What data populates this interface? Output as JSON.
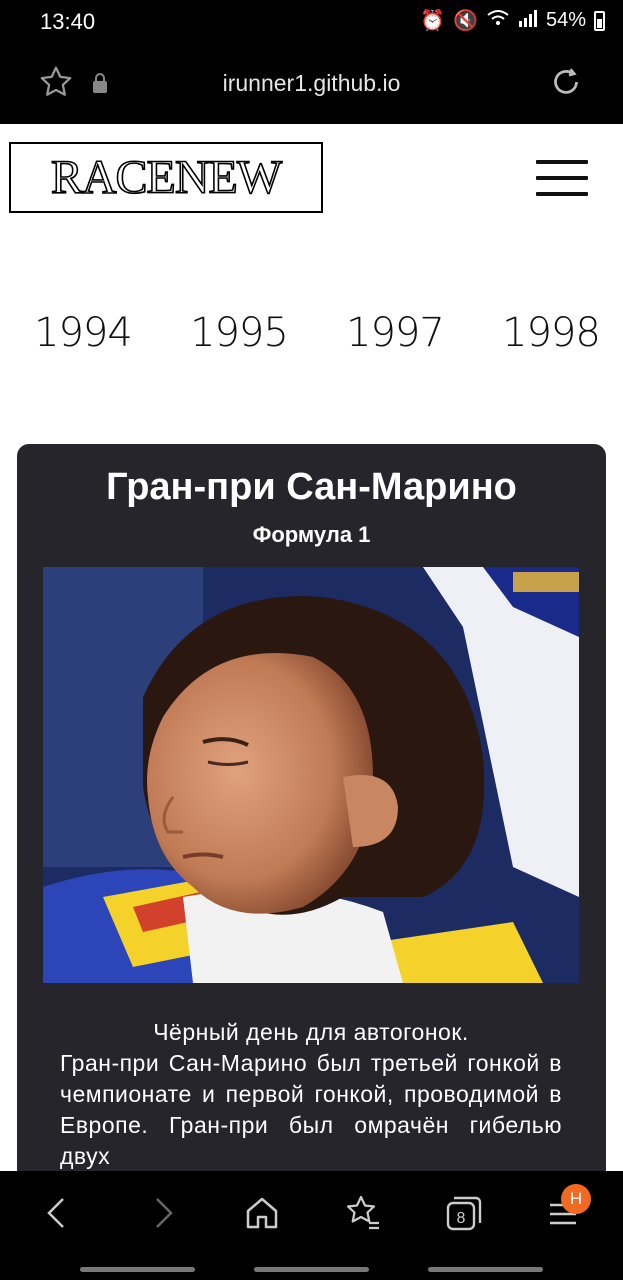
{
  "status_bar": {
    "time": "13:40",
    "battery": "54%"
  },
  "browser": {
    "url": "irunner1.github.io",
    "tab_count": "8",
    "menu_badge": "Н"
  },
  "site": {
    "logo": "RACENEW"
  },
  "years": [
    "1994",
    "1995",
    "1997",
    "1998"
  ],
  "card": {
    "title": "Гран-при Сан-Марино",
    "subtitle": "Формула 1",
    "description_first": "Чёрный день для автогонок.",
    "description_rest": "Гран-при Сан-Марино был третьей гонкой в чемпионате и первой гонкой, проводимой в Европе. Гран-при был омрачён гибелью двух"
  },
  "icons": {
    "favorite": "star-icon",
    "lock": "lock-icon",
    "reload": "reload-icon",
    "back": "back-icon",
    "forward": "forward-icon",
    "home": "home-icon",
    "bookmarks": "bookmarks-icon",
    "tabs": "tabs-icon",
    "menu": "menu-icon"
  }
}
